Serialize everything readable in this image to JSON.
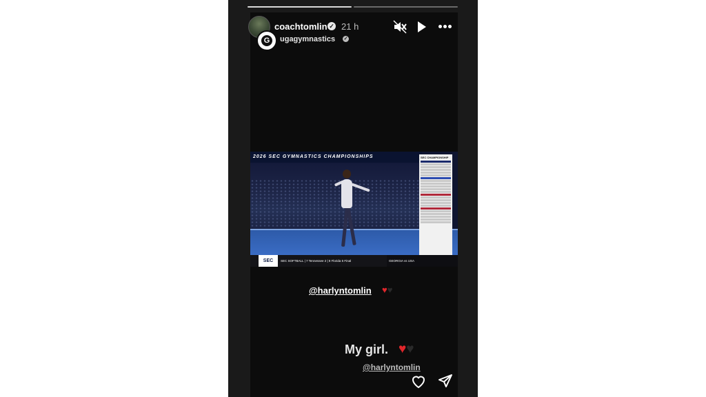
{
  "header": {
    "username": "coachtomlin",
    "time_ago": "21 h",
    "shared_from": "ugagymnastics",
    "badge_letter": "G"
  },
  "video": {
    "banner_text": "2026 SEC GYMNASTICS CHAMPIONSHIPS",
    "scoreboard_title": "SEC CHAMPIONSHIP",
    "ticker_logo": "SEC",
    "ticker_text": "SEC SOFTBALL  |  7 Tennessee   2  |  8 Florida   5  Final",
    "ticker_right": "GEORGIA vs  USA"
  },
  "stickers": {
    "mention_main": "@harlyntomlin",
    "caption": "My girl.",
    "mention_sub": "@harlyntomlin"
  },
  "colors": {
    "heart_red": "#e0262b",
    "heart_black": "#2a2a2a",
    "floor_blue": "#3a6cc4"
  },
  "icons": {
    "mute": "speaker-muted-icon",
    "play": "play-icon",
    "more": "more-dots-icon",
    "like": "heart-outline-icon",
    "share": "paper-plane-icon"
  }
}
